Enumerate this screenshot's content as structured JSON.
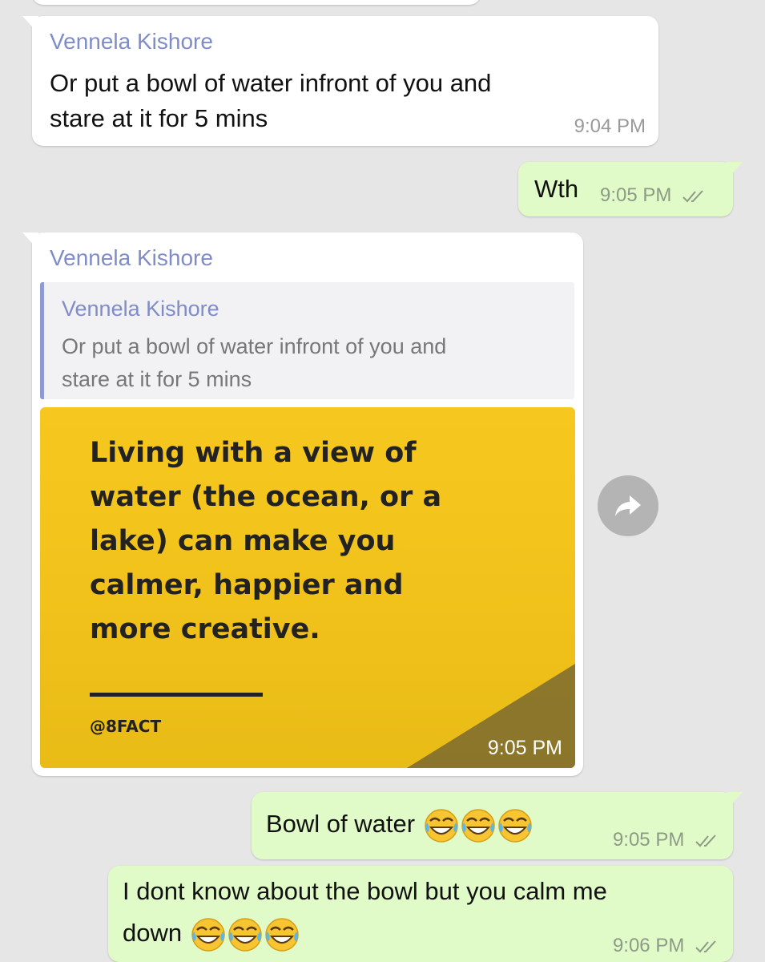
{
  "messages": [
    {
      "sender": "Vennela Kishore",
      "text_line1": "Or put a bowl of water infront of you and",
      "text_line2": "stare at it for 5 mins",
      "time": "9:04 PM"
    },
    {
      "text": "Wth",
      "time": "9:05 PM"
    },
    {
      "sender": "Vennela Kishore",
      "reply": {
        "sender": "Vennela Kishore",
        "text_line1": "Or put a bowl of water infront of you and",
        "text_line2": "stare at it for 5 mins"
      },
      "image": {
        "lines": [
          "Living with a view of",
          "water (the ocean, or a",
          "lake) can make you",
          "calmer, happier and",
          "more creative."
        ],
        "handle": "@8FACT",
        "time": "9:05 PM"
      }
    },
    {
      "text": "Bowl of water",
      "emoji": "tears-of-joy",
      "emoji_count": 3,
      "time": "9:05 PM"
    },
    {
      "text_line1": "I dont know about the bowl but you calm me",
      "text_line2": "down",
      "emoji": "tears-of-joy",
      "emoji_count": 3,
      "time": "9:06 PM"
    }
  ],
  "colors": {
    "background": "#e6e6e6",
    "incoming_bubble": "#ffffff",
    "outgoing_bubble": "#e1fbc8",
    "sender_name": "#7f8cc8",
    "image_yellow": "#f6c81f"
  },
  "icons": {
    "forward": "forward-arrow-icon",
    "read_receipt": "double-check-icon"
  }
}
